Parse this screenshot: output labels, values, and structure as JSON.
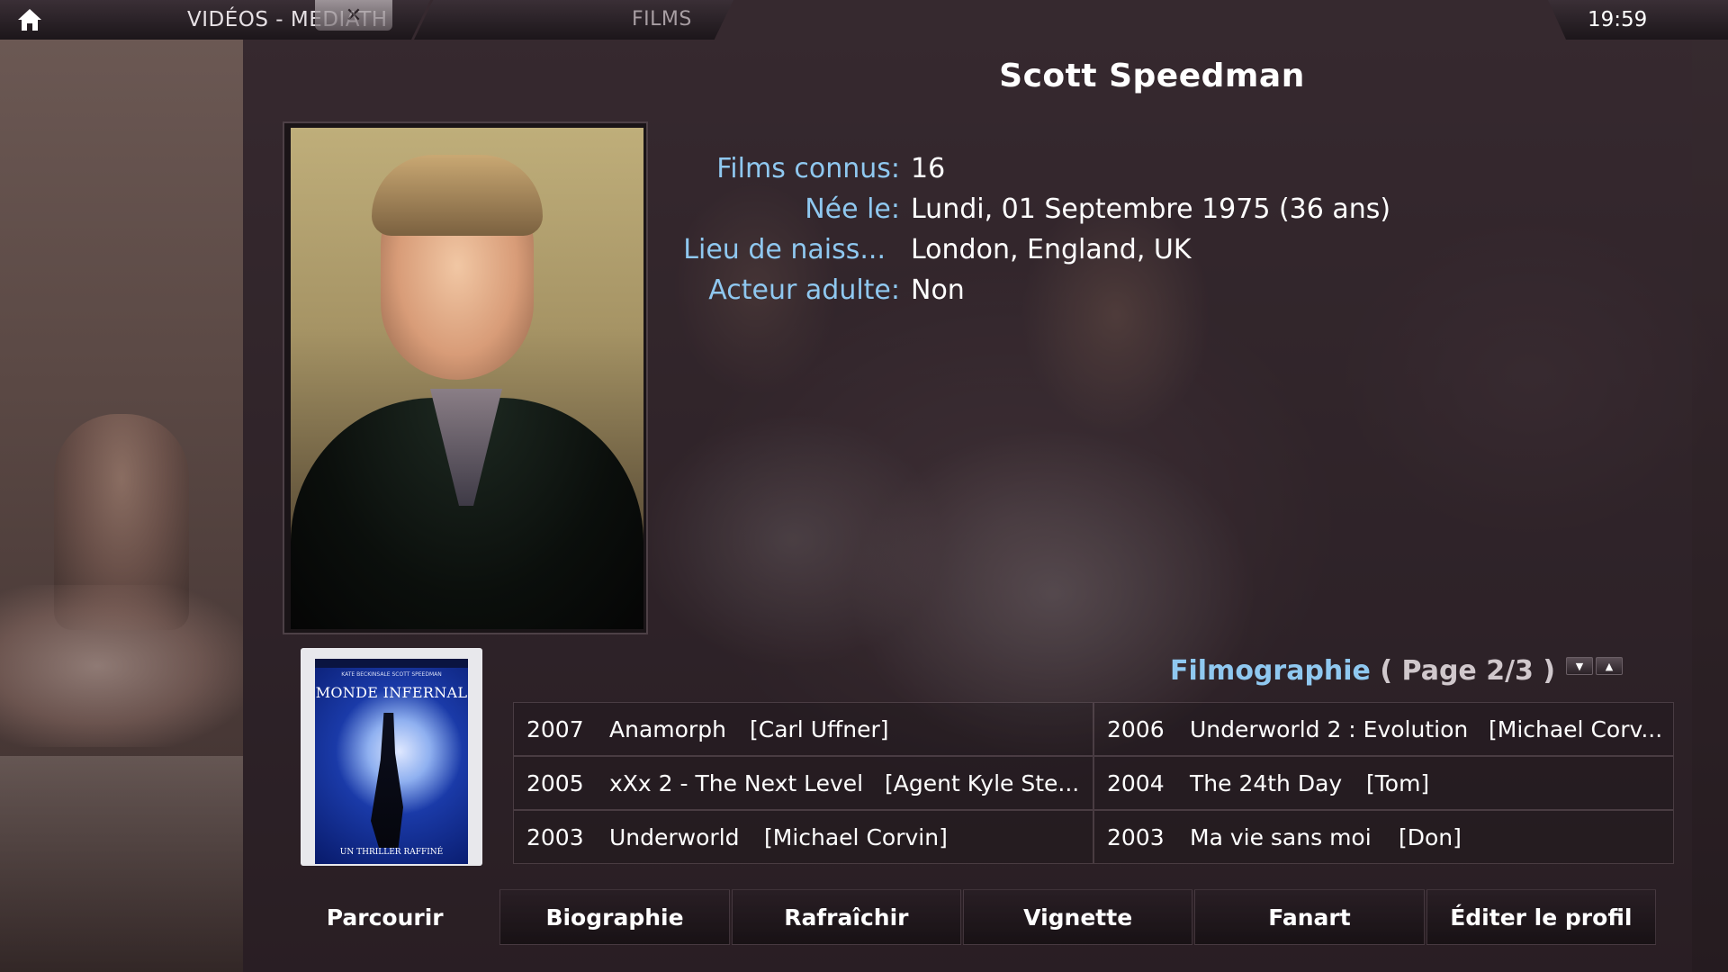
{
  "topbar": {
    "breadcrumb_main": "VIDÉOS - MEDIATH",
    "breadcrumb_sub": "FILMS",
    "clock": "19:59",
    "home_icon": "home-icon",
    "close_icon": "close-icon"
  },
  "person": {
    "name": "Scott Speedman",
    "info": [
      {
        "label": "Films connus:",
        "value": "16"
      },
      {
        "label": "Née le:",
        "value": "Lundi, 01 Septembre 1975 (36 ans)"
      },
      {
        "label": "Lieu de naiss...",
        "value": "London, England, UK"
      },
      {
        "label": "Acteur adulte:",
        "value": "Non"
      }
    ]
  },
  "poster": {
    "title": "MONDE INFERNAL",
    "names": "KATE BECKINSALE    SCOTT SPEEDMAN",
    "tagline": "UN THRILLER RAFFINÉ"
  },
  "filmography": {
    "title": "Filmographie",
    "page": "( Page 2/3 )",
    "films": [
      {
        "year": "2007",
        "title": "Anamorph",
        "role": "[Carl Uffner]"
      },
      {
        "year": "2006",
        "title": "Underworld 2 : Evolution",
        "role": "[Michael Corv..."
      },
      {
        "year": "2005",
        "title": "xXx 2 - The Next Level",
        "role": "[Agent Kyle Ste..."
      },
      {
        "year": "2004",
        "title": "The 24th Day",
        "role": "[Tom]"
      },
      {
        "year": "2003",
        "title": "Underworld",
        "role": "[Michael Corvin]"
      },
      {
        "year": "2003",
        "title": "Ma vie sans moi",
        "role": "[Don]"
      }
    ]
  },
  "buttons": {
    "browse": "Parcourir",
    "biography": "Biographie",
    "refresh": "Rafraîchir",
    "thumbnail": "Vignette",
    "fanart": "Fanart",
    "edit_profile": "Éditer le profil"
  },
  "colors": {
    "label_blue": "#8fc8f0",
    "text_white": "#ffffff"
  }
}
